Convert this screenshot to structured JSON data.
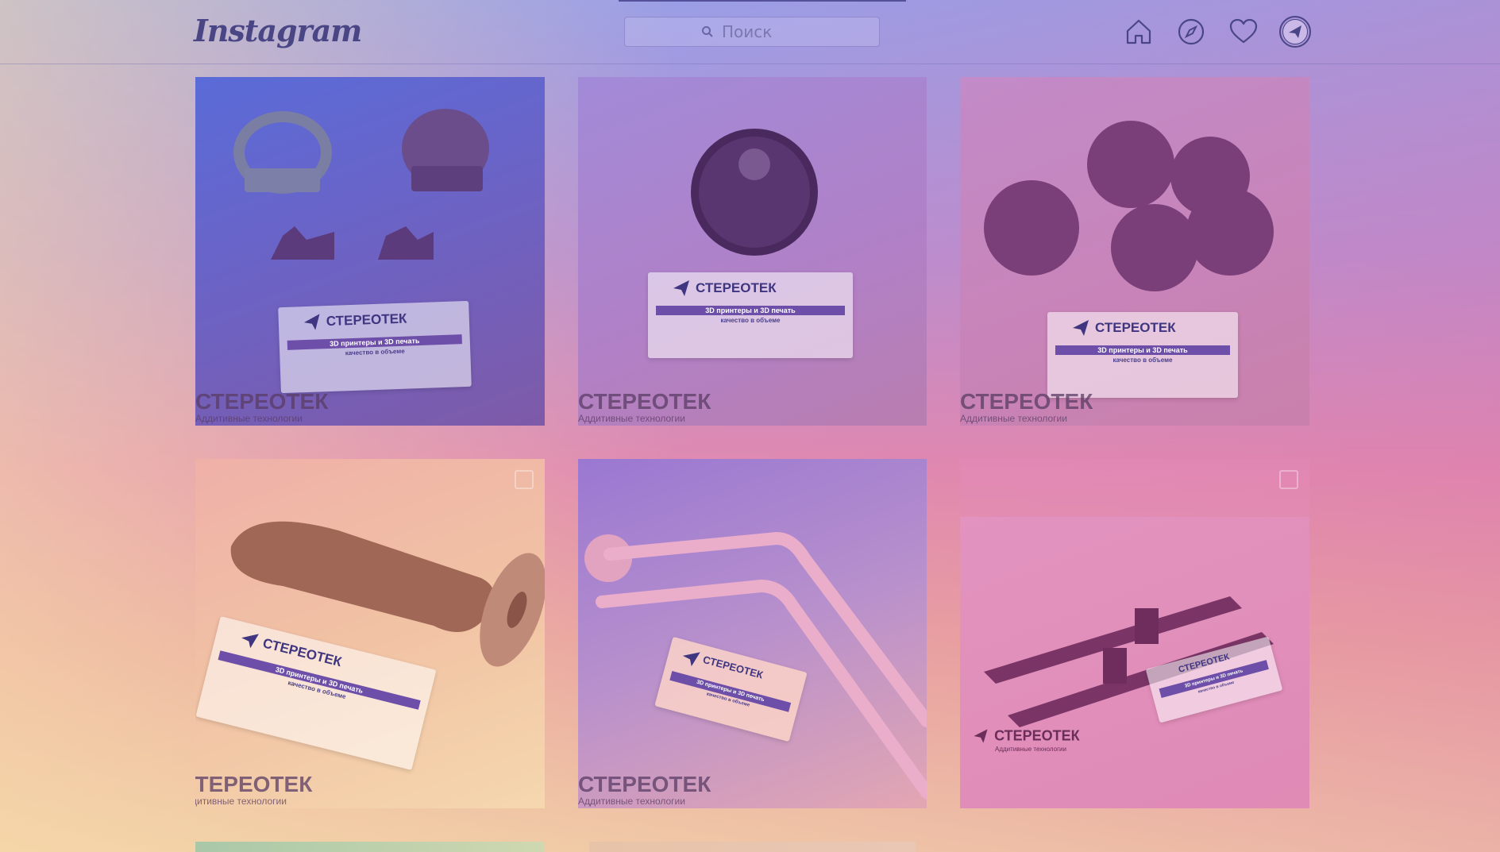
{
  "app": {
    "logo": "Instagram"
  },
  "search": {
    "placeholder": "Поиск"
  },
  "nav": {
    "icons": [
      "home-icon",
      "explore-compass-icon",
      "activity-heart-icon",
      "profile-avatar-icon"
    ]
  },
  "posts": [
    {
      "watermark": "СТЕРЕОТЕК",
      "watermark_sub": "Аддитивные технологии",
      "card": {
        "brand": "СТЕРЕОТЕК",
        "stripe": "3D принтеры и 3D печать",
        "tag": "качество в объеме"
      }
    },
    {
      "watermark": "СТЕРЕОТЕК",
      "watermark_sub": "Аддитивные технологии",
      "card": {
        "brand": "СТЕРЕОТЕК",
        "stripe": "3D принтеры и 3D печать",
        "tag": "качество в объеме"
      }
    },
    {
      "watermark": "СТЕРЕОТЕК",
      "watermark_sub": "Аддитивные технологии",
      "card": {
        "brand": "СТЕРЕОТЕК",
        "stripe": "3D принтеры и 3D печать",
        "tag": "качество в объеме"
      }
    },
    {
      "watermark": "СТЕРЕОТЕК",
      "watermark_sub": "Аддитивные технологии",
      "card": {
        "brand": "СТЕРЕОТЕК",
        "stripe": "3D принтеры и 3D печать",
        "tag": "качество в объеме"
      }
    },
    {
      "watermark": "СТЕРЕОТЕК",
      "watermark_sub": "Аддитивные технологии",
      "card": {
        "brand": "СТЕРЕОТЕК",
        "stripe": "3D принтеры и 3D печать",
        "tag": "качество в объеме"
      }
    },
    {
      "watermark": "СТЕРЕОТЕК",
      "watermark_sub": "Аддитивные технологии",
      "card": {
        "brand": "СТЕРЕОТЕК",
        "stripe": "3D принтеры и 3D печать",
        "tag": "качество в объеме"
      }
    }
  ],
  "colors": {
    "accent": "#4a4685",
    "overlay_top": "#9a9ee6",
    "overlay_bottom": "#e08ab0"
  }
}
